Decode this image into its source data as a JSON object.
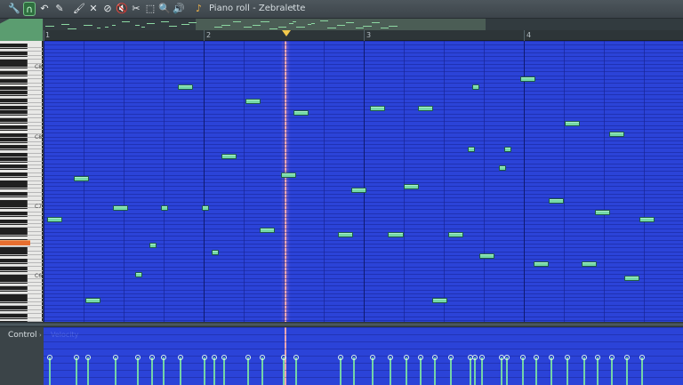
{
  "window": {
    "title": "Piano roll - Zebralette",
    "colors": {
      "background": "#3a4248",
      "grid": "#2b43d8",
      "note": "#75d9a7",
      "playhead": "#e7a6b5",
      "active_tool": "#2f6e3f"
    }
  },
  "toolbar": {
    "tools": [
      {
        "name": "wrench-icon",
        "glyph": "🔧"
      },
      {
        "name": "magnet-icon",
        "glyph": "∩"
      },
      {
        "name": "undo-icon",
        "glyph": "↶"
      },
      {
        "name": "pencil-icon",
        "glyph": "✎"
      },
      {
        "name": "paintbrush-icon",
        "glyph": "🖌"
      },
      {
        "name": "erase-icon",
        "glyph": "✕"
      },
      {
        "name": "delete-icon",
        "glyph": "⊘"
      },
      {
        "name": "mute-icon",
        "glyph": "🔇"
      },
      {
        "name": "slice-icon",
        "glyph": "✂"
      },
      {
        "name": "select-icon",
        "glyph": "⬚"
      },
      {
        "name": "zoom-icon",
        "glyph": "🔍"
      },
      {
        "name": "volume-icon",
        "glyph": "🔊"
      }
    ],
    "active_tool": "magnet-icon",
    "speaker_icon": "speaker-icon",
    "title_arrow": "›"
  },
  "timeline": {
    "bars": [
      "1",
      "2",
      "3",
      "4"
    ]
  },
  "keyboard": {
    "labels": [
      "C8",
      "C8",
      "C7",
      "C6"
    ]
  },
  "notes": [
    {
      "start": 0.03,
      "length": 0.18,
      "row": 46
    },
    {
      "start": 0.25,
      "length": 0.18,
      "row": 35
    },
    {
      "start": 0.35,
      "length": 0.18,
      "row": 68
    },
    {
      "start": 0.58,
      "length": 0.18,
      "row": 43
    },
    {
      "start": 0.76,
      "length": 0.06,
      "row": 61
    },
    {
      "start": 0.88,
      "length": 0.06,
      "row": 53
    },
    {
      "start": 0.98,
      "length": 0.06,
      "row": 43
    },
    {
      "start": 1.12,
      "length": 0.18,
      "row": 10
    },
    {
      "start": 1.32,
      "length": 0.06,
      "row": 43
    },
    {
      "start": 1.4,
      "length": 0.06,
      "row": 55
    },
    {
      "start": 1.48,
      "length": 0.18,
      "row": 29
    },
    {
      "start": 1.68,
      "length": 0.18,
      "row": 14
    },
    {
      "start": 1.8,
      "length": 0.18,
      "row": 49
    },
    {
      "start": 1.98,
      "length": 0.18,
      "row": 34
    },
    {
      "start": 2.08,
      "length": 0.18,
      "row": 17
    },
    {
      "start": 2.45,
      "length": 0.18,
      "row": 50
    },
    {
      "start": 2.56,
      "length": 0.18,
      "row": 38
    },
    {
      "start": 2.72,
      "length": 0.18,
      "row": 16
    },
    {
      "start": 2.87,
      "length": 0.18,
      "row": 50
    },
    {
      "start": 3.0,
      "length": 0.18,
      "row": 37
    },
    {
      "start": 3.12,
      "length": 0.18,
      "row": 16
    },
    {
      "start": 3.24,
      "length": 0.18,
      "row": 68
    },
    {
      "start": 3.37,
      "length": 0.18,
      "row": 50
    },
    {
      "start": 3.53,
      "length": 0.06,
      "row": 27
    },
    {
      "start": 3.57,
      "length": 0.06,
      "row": 10
    },
    {
      "start": 3.63,
      "length": 0.18,
      "row": 56
    },
    {
      "start": 3.79,
      "length": 0.06,
      "row": 32
    },
    {
      "start": 3.84,
      "length": 0.06,
      "row": 27
    },
    {
      "start": 3.97,
      "length": 0.18,
      "row": 8
    },
    {
      "start": 4.08,
      "length": 0.18,
      "row": 58
    },
    {
      "start": 4.21,
      "length": 0.18,
      "row": 41
    },
    {
      "start": 4.34,
      "length": 0.18,
      "row": 20
    },
    {
      "start": 4.48,
      "length": 0.18,
      "row": 58
    },
    {
      "start": 4.59,
      "length": 0.18,
      "row": 44
    },
    {
      "start": 4.71,
      "length": 0.18,
      "row": 23
    },
    {
      "start": 4.84,
      "length": 0.18,
      "row": 62
    },
    {
      "start": 4.96,
      "length": 0.18,
      "row": 46
    }
  ],
  "control": {
    "label": "Control",
    "arrow": "›",
    "lane_name": "Velocity",
    "velocity_level": 0.52
  },
  "playhead_position_bars": 2.5
}
